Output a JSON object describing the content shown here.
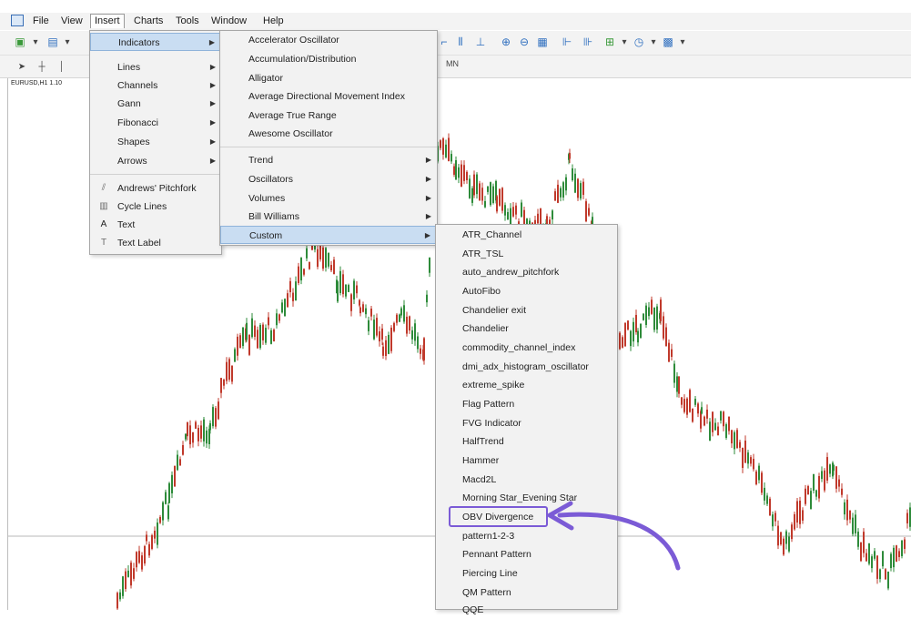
{
  "menubar": {
    "file": "File",
    "view": "View",
    "insert": "Insert",
    "charts": "Charts",
    "tools": "Tools",
    "window": "Window",
    "help": "Help"
  },
  "toolbar": {
    "tf_label": "MN"
  },
  "chart": {
    "symbol": "EURUSD,H1 1.10"
  },
  "insert_menu": {
    "items": [
      "Indicators",
      "Lines",
      "Channels",
      "Gann",
      "Fibonacci",
      "Shapes",
      "Arrows",
      "Andrews' Pitchfork",
      "Cycle Lines",
      "Text",
      "Text Label"
    ]
  },
  "indicators_menu": {
    "items": [
      "Accelerator Oscillator",
      "Accumulation/Distribution",
      "Alligator",
      "Average Directional Movement Index",
      "Average True Range",
      "Awesome Oscillator",
      "Trend",
      "Oscillators",
      "Volumes",
      "Bill Williams",
      "Custom"
    ]
  },
  "custom_menu": {
    "items": [
      "ATR_Channel",
      "ATR_TSL",
      "auto_andrew_pitchfork",
      "AutoFibo",
      "Chandelier exit",
      "Chandelier",
      "commodity_channel_index",
      "dmi_adx_histogram_oscillator",
      "extreme_spike",
      "Flag Pattern",
      "FVG Indicator",
      "HalfTrend",
      "Hammer",
      "Macd2L",
      "Morning Star_Evening Star",
      "OBV Divergence",
      "pattern1-2-3",
      "Pennant Pattern",
      "Piercing Line",
      "QM Pattern",
      "QQE"
    ]
  },
  "colors": {
    "bull": "#2e8b3a",
    "bear": "#c0392b",
    "highlight": "#c9ddf2",
    "annotation": "#7b5bd6"
  },
  "icons": {
    "andrews_pitchfork": "pitchfork-icon",
    "cycle_lines": "cycle-lines-icon",
    "text": "text-icon",
    "text_label": "text-label-icon"
  }
}
